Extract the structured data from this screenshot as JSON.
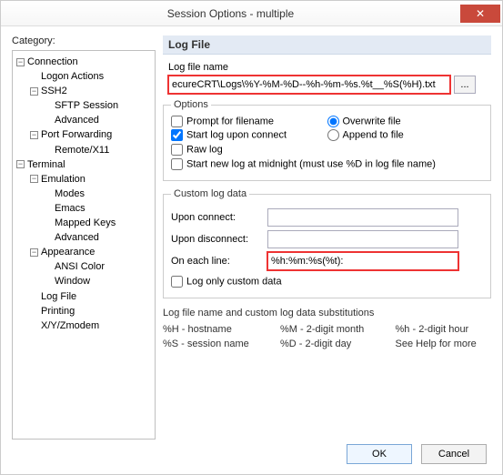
{
  "window": {
    "title": "Session Options - multiple"
  },
  "category_label": "Category:",
  "tree": {
    "connection": "Connection",
    "logon_actions": "Logon Actions",
    "ssh2": "SSH2",
    "sftp_session": "SFTP Session",
    "advanced_ssh": "Advanced",
    "port_forwarding": "Port Forwarding",
    "remote_x11": "Remote/X11",
    "terminal": "Terminal",
    "emulation": "Emulation",
    "modes": "Modes",
    "emacs": "Emacs",
    "mapped_keys": "Mapped Keys",
    "advanced_emu": "Advanced",
    "appearance": "Appearance",
    "ansi_color": "ANSI Color",
    "window_item": "Window",
    "log_file": "Log File",
    "printing": "Printing",
    "xyzmodem": "X/Y/Zmodem"
  },
  "panel": {
    "header": "Log File",
    "logname_label": "Log file name",
    "logname_value": "ecureCRT\\Logs\\%Y-%M-%D--%h-%m-%s.%t__%S(%H).txt",
    "browse": "...",
    "options_legend": "Options",
    "prompt_label": "Prompt for filename",
    "overwrite_label": "Overwrite file",
    "startlog_label": "Start log upon connect",
    "append_label": "Append to file",
    "rawlog_label": "Raw log",
    "midnight_label": "Start new log at midnight (must use %D in log file name)",
    "custom_legend": "Custom log data",
    "upon_connect_label": "Upon connect:",
    "upon_connect_value": "",
    "upon_disconnect_label": "Upon disconnect:",
    "upon_disconnect_value": "",
    "each_line_label": "On each line:",
    "each_line_value": "%h:%m:%s(%t):",
    "log_only_custom_label": "Log only custom data",
    "subst_header": "Log file name and custom log data substitutions",
    "subst": {
      "a1": "%H - hostname",
      "a2": "%M - 2-digit month",
      "a3": "%h - 2-digit hour",
      "b1": "%S - session name",
      "b2": "%D - 2-digit day",
      "b3": "See Help for more"
    }
  },
  "buttons": {
    "ok": "OK",
    "cancel": "Cancel"
  },
  "state": {
    "prompt": false,
    "overwrite": true,
    "startlog": true,
    "append": false,
    "rawlog": false,
    "midnight": false,
    "log_only_custom": false
  },
  "glyph": {
    "close": "✕",
    "minus": "−"
  }
}
